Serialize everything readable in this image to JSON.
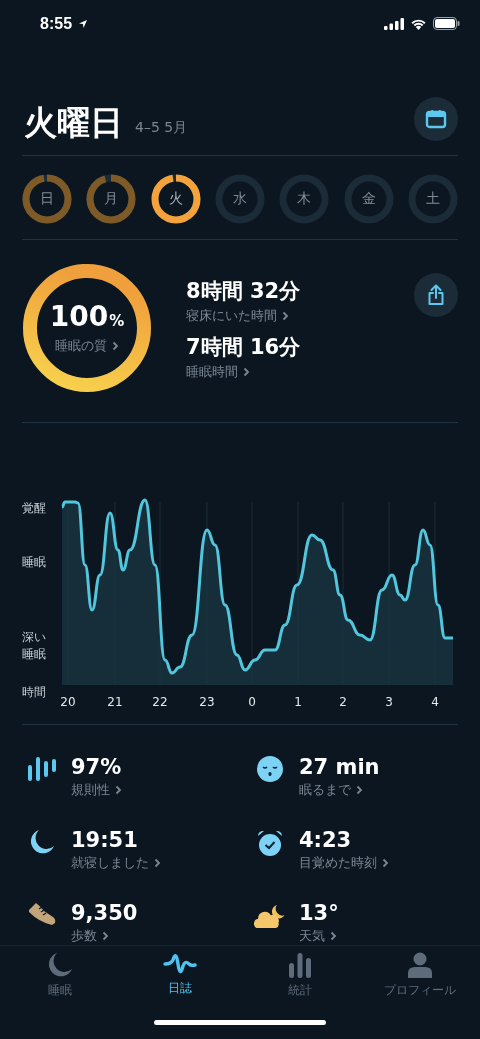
{
  "status_bar": {
    "time": "8:55"
  },
  "header": {
    "title": "火曜日",
    "date_range": "4–5 5月"
  },
  "days": [
    {
      "label": "日",
      "level": 0.97,
      "selected": false
    },
    {
      "label": "月",
      "level": 0.95,
      "selected": false
    },
    {
      "label": "火",
      "level": 0.97,
      "selected": true
    },
    {
      "label": "水",
      "selected": false
    },
    {
      "label": "木",
      "selected": false
    },
    {
      "label": "金",
      "selected": false
    },
    {
      "label": "土",
      "selected": false
    }
  ],
  "quality": {
    "value": "100",
    "unit": "%",
    "label": "睡眠の質",
    "level": 0.99
  },
  "durations": [
    {
      "value": "8時間 32分",
      "label": "寝床にいた時間"
    },
    {
      "value": "7時間 16分",
      "label": "睡眠時間"
    }
  ],
  "chart": {
    "y_labels": [
      "覚醒",
      "睡眠",
      "深い睡眠"
    ],
    "axis_label": "時間",
    "x_labels": [
      "20",
      "21",
      "22",
      "23",
      "0",
      "1",
      "2",
      "3",
      "4"
    ]
  },
  "stats": [
    {
      "kind": "regularity",
      "value": "97%",
      "label": "規則性"
    },
    {
      "kind": "latency",
      "value": "27 min",
      "label": "眠るまで"
    },
    {
      "kind": "bedtime",
      "value": "19:51",
      "label": "就寝しました"
    },
    {
      "kind": "wake",
      "value": "4:23",
      "label": "目覚めた時刻"
    },
    {
      "kind": "steps",
      "value": "9,350",
      "label": "歩数"
    },
    {
      "kind": "weather",
      "value": "13°",
      "label": "天気"
    }
  ],
  "tabs": [
    {
      "kind": "sleep",
      "label": "睡眠",
      "selected": false
    },
    {
      "kind": "journal",
      "label": "日誌",
      "selected": true
    },
    {
      "kind": "stats",
      "label": "統計",
      "selected": false
    },
    {
      "kind": "profile",
      "label": "プロフィール",
      "selected": false
    }
  ]
}
